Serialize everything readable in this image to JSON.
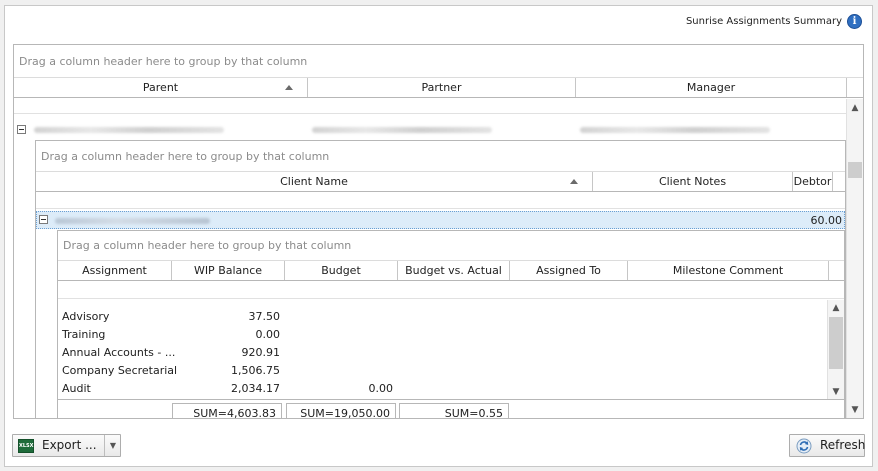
{
  "header": {
    "title": "Sunrise Assignments Summary",
    "info_glyph": "i"
  },
  "outer_grid": {
    "group_hint": "Drag a column header here to group by that column",
    "columns": [
      "Parent",
      "Partner",
      "Manager"
    ]
  },
  "client_grid": {
    "group_hint": "Drag a column header here to group by that column",
    "columns": [
      "Client Name",
      "Client Notes",
      "Debtor"
    ],
    "selected_row_debtor": "60.00"
  },
  "assignment_grid": {
    "group_hint": "Drag a column header here to group by that column",
    "columns": [
      "Assignment",
      "WIP Balance",
      "Budget",
      "Budget vs. Actual",
      "Assigned To",
      "Milestone Comment"
    ],
    "rows": [
      {
        "assignment": "Advisory",
        "wip": "37.50",
        "budget": ""
      },
      {
        "assignment": "Training",
        "wip": "0.00",
        "budget": ""
      },
      {
        "assignment": "Annual Accounts - ...",
        "wip": "920.91",
        "budget": ""
      },
      {
        "assignment": "Company Secretarial",
        "wip": "1,506.75",
        "budget": ""
      },
      {
        "assignment": "Audit",
        "wip": "2,034.17",
        "budget": "0.00"
      }
    ],
    "sums": {
      "wip": "SUM=4,603.83",
      "budget": "SUM=19,050.00",
      "budget_vs_actual": "SUM=0.55"
    }
  },
  "toolbar": {
    "export_label": "Export ...",
    "refresh_label": "Refresh",
    "xlsx_icon_text": "XLSX"
  },
  "colors": {
    "selection": "#ddecf9",
    "info_icon": "#2f6fc1",
    "excel_icon": "#1e6b3a"
  }
}
